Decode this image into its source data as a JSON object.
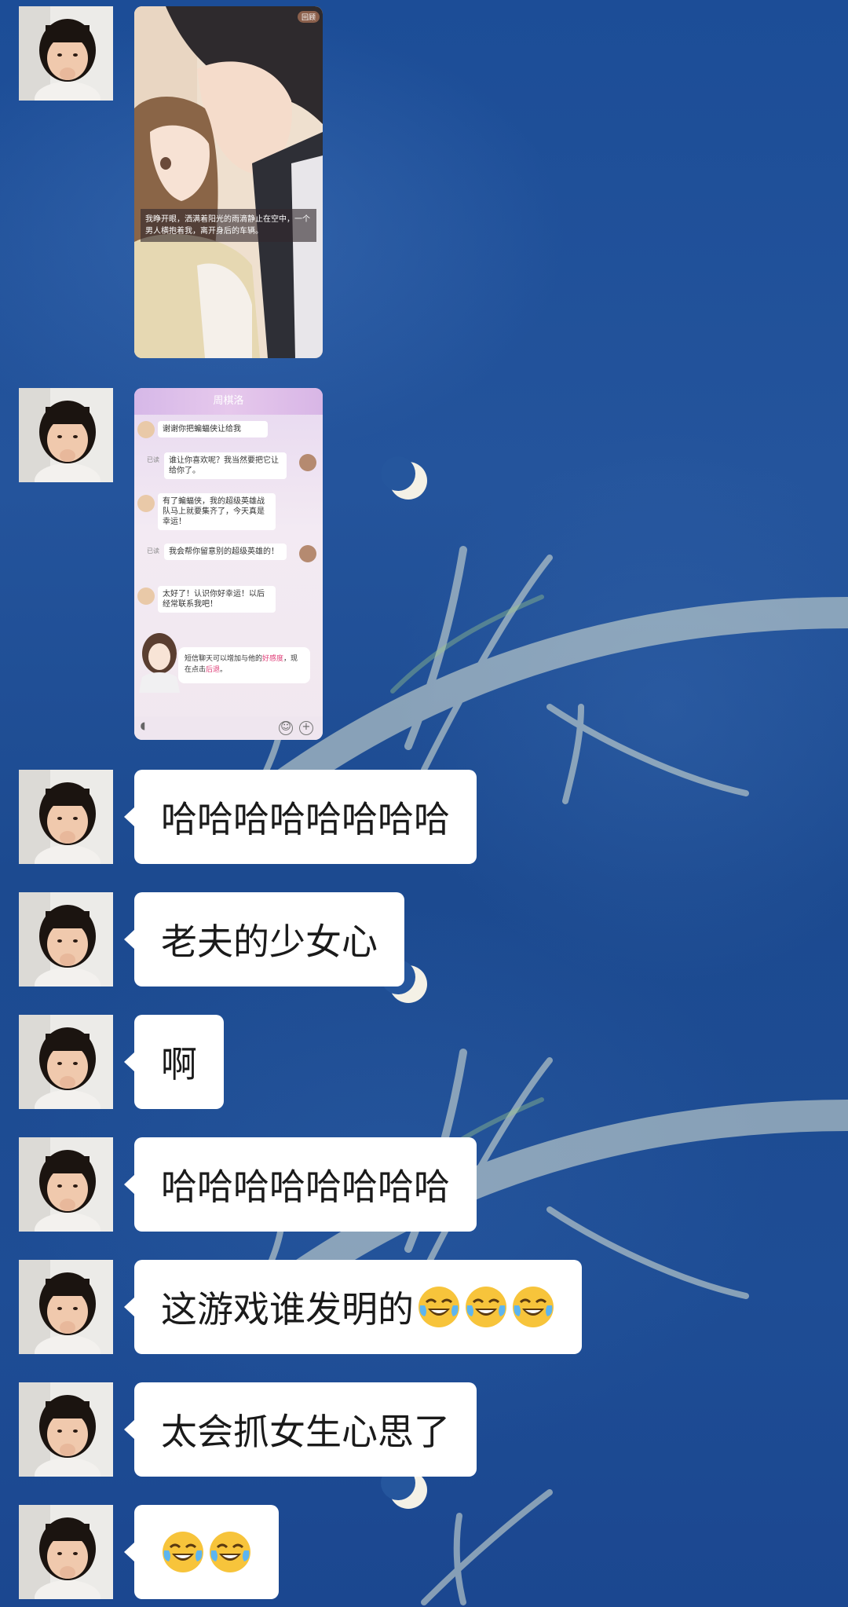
{
  "game_screenshot": {
    "story_text": "我睁开眼，洒满着阳光的雨滴静止在空中，一个男人横抱着我，离开身后的车辆。",
    "badge": "回顾"
  },
  "chat_screenshot": {
    "header_title": "周棋洛",
    "messages": [
      {
        "side": "left",
        "text": "谢谢你把蝙蝠侠让给我"
      },
      {
        "side": "right",
        "text": "谁让你喜欢呢？我当然要把它让给你了。",
        "status": "已读"
      },
      {
        "side": "left",
        "text": "有了蝙蝠侠，我的超级英雄战队马上就要集齐了，今天真是幸运！"
      },
      {
        "side": "right",
        "text": "我会帮你留意别的超级英雄的！",
        "status": "已读"
      },
      {
        "side": "left",
        "text": "太好了！认识你好幸运！以后经常联系我吧！"
      }
    ],
    "tip_part1": "短信聊天可以增加与他的",
    "tip_highlight1": "好感度",
    "tip_part2": "，现在点击",
    "tip_highlight2": "后退",
    "tip_part3": "。"
  },
  "messages": [
    {
      "text": "哈哈哈哈哈哈哈哈"
    },
    {
      "text": "老夫的少女心"
    },
    {
      "text": "啊"
    },
    {
      "text": "哈哈哈哈哈哈哈哈"
    },
    {
      "text": "这游戏谁发明的",
      "emoji": [
        "crying-laughing",
        "crying-laughing",
        "crying-laughing"
      ]
    },
    {
      "text": "太会抓女生心思了"
    },
    {
      "text": "",
      "emoji": [
        "crying-laughing",
        "crying-laughing"
      ]
    }
  ],
  "colors": {
    "background": "#1d4a93",
    "bubble": "#ffffff",
    "text": "#1a1a1a",
    "highlight": "#e0407a"
  }
}
